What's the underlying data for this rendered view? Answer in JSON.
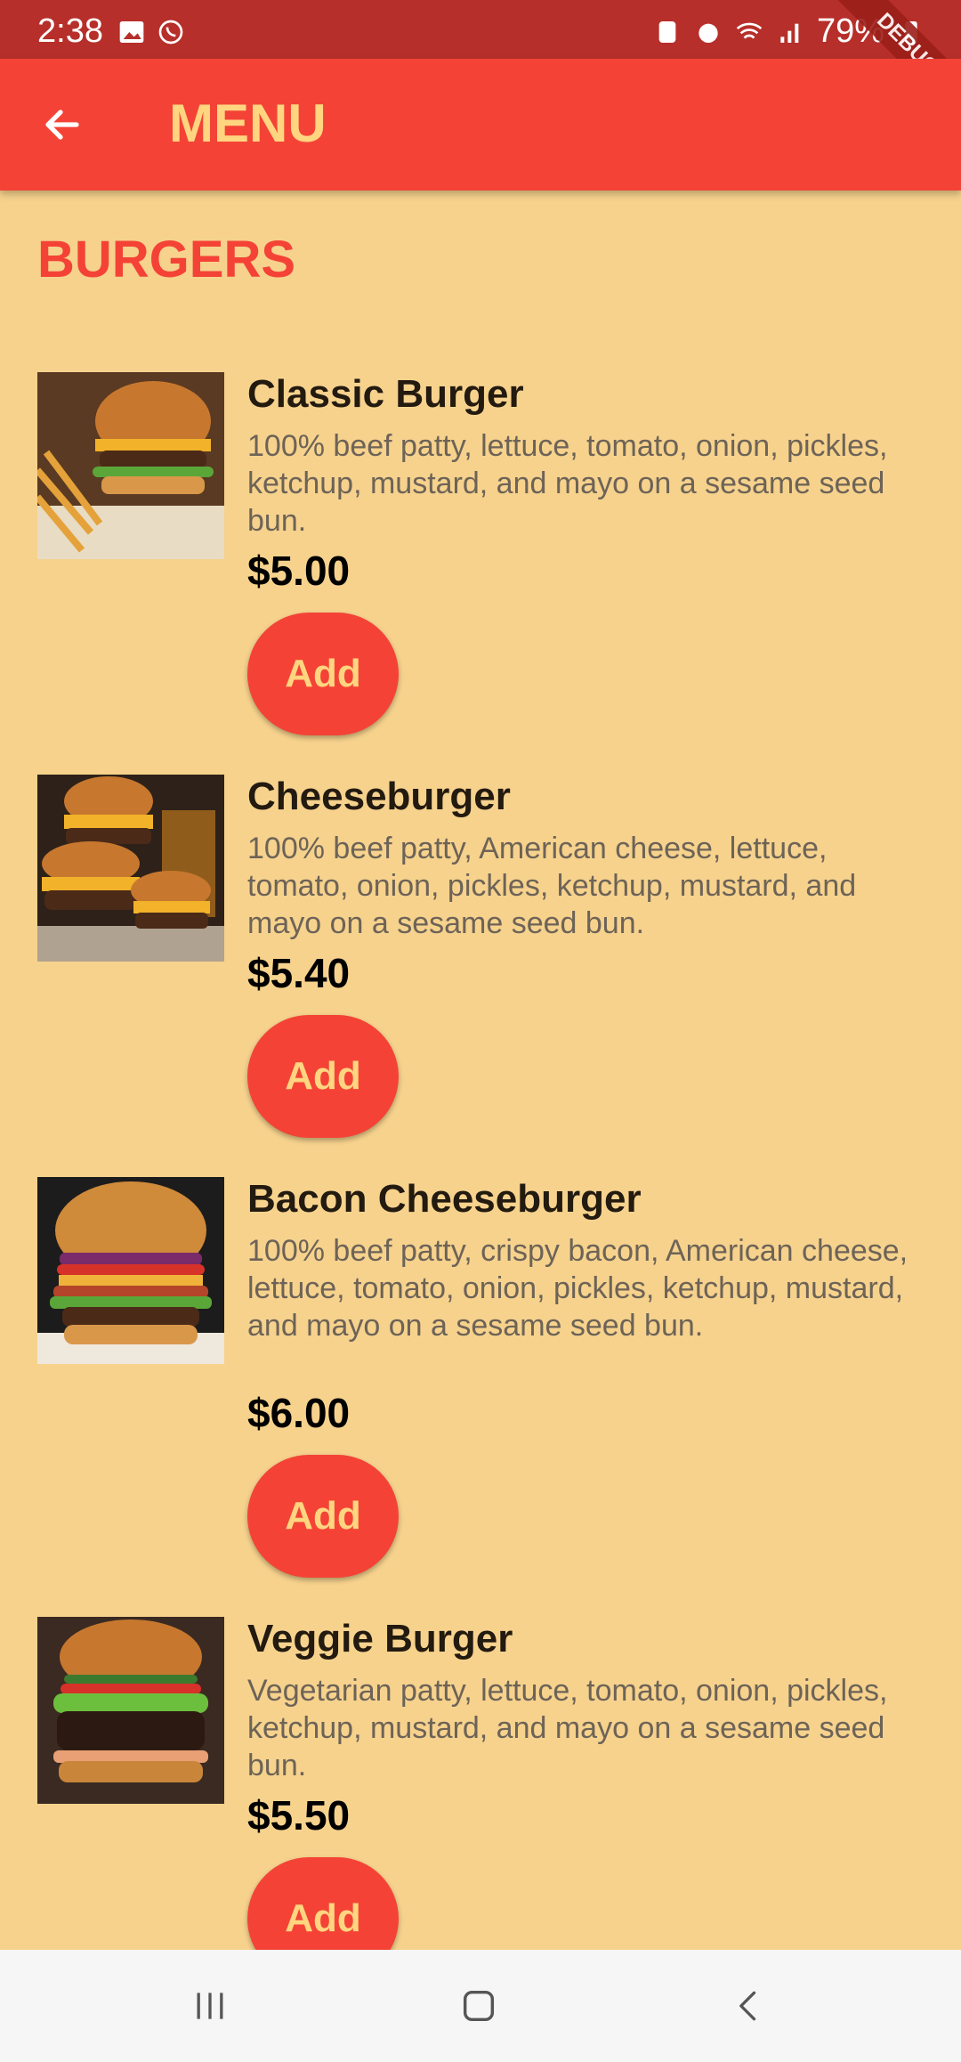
{
  "status_bar": {
    "time": "2:38",
    "battery": "79%"
  },
  "debug_banner": "DEBUG",
  "app_bar": {
    "title": "MENU"
  },
  "section": {
    "title": "BURGERS"
  },
  "items": [
    {
      "name": "Classic Burger",
      "description": "100% beef patty, lettuce, tomato, onion, pickles, ketchup, mustard, and mayo on a sesame seed bun.",
      "price": "$5.00",
      "add_label": "Add"
    },
    {
      "name": "Cheeseburger",
      "description": "100% beef patty, American cheese, lettuce, tomato, onion, pickles, ketchup, mustard, and mayo on a sesame seed bun.",
      "price": "$5.40",
      "add_label": "Add"
    },
    {
      "name": "Bacon Cheeseburger",
      "description": "100% beef patty, crispy bacon, American cheese, lettuce, tomato, onion, pickles, ketchup, mustard, and mayo on a sesame seed bun.",
      "price": "$6.00",
      "add_label": "Add"
    },
    {
      "name": "Veggie Burger",
      "description": "Vegetarian patty, lettuce, tomato, onion, pickles, ketchup, mustard, and mayo on a sesame seed bun.",
      "price": "$5.50",
      "add_label": "Add"
    }
  ],
  "colors": {
    "primary": "#F44336",
    "accent_text": "#FFD580",
    "background": "#F6D28D",
    "status_bar": "#B72F2A"
  },
  "icons": {
    "back": "arrow-left-icon",
    "nav_recents": "recents-icon",
    "nav_home": "home-icon",
    "nav_back": "nav-back-icon"
  }
}
